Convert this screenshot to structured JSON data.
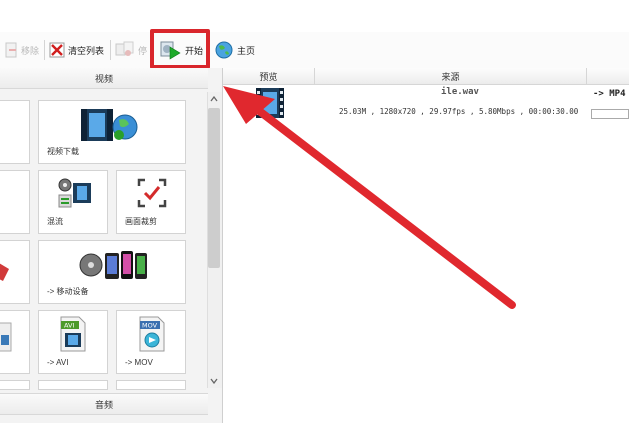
{
  "toolbar": {
    "remove_label": "移除",
    "clear_list_label": "清空列表",
    "fourth_label": "停",
    "start_label": "开始",
    "home_label": "主页"
  },
  "left_panel": {
    "video_category": "视频",
    "audio_category": "音频",
    "tiles": [
      {
        "label": "视频下载"
      },
      {
        "label": "混流"
      },
      {
        "label": "画面裁剪"
      },
      {
        "label": "-> 移动设备"
      },
      {
        "label": "-> AVI"
      },
      {
        "label": "-> MOV"
      }
    ],
    "badges": {
      "avi": "AVI",
      "mov": "MOV"
    }
  },
  "file_list": {
    "columns": {
      "preview": "预览",
      "source": "来源"
    },
    "file": {
      "name": "ile.wav",
      "info": "25.03M , 1280x720 , 29.97fps , 5.80Mbps , 00:00:30.00",
      "output_format": "-> MP4"
    }
  },
  "colors": {
    "highlight": "#d9262c",
    "arrow": "#e0282e"
  }
}
